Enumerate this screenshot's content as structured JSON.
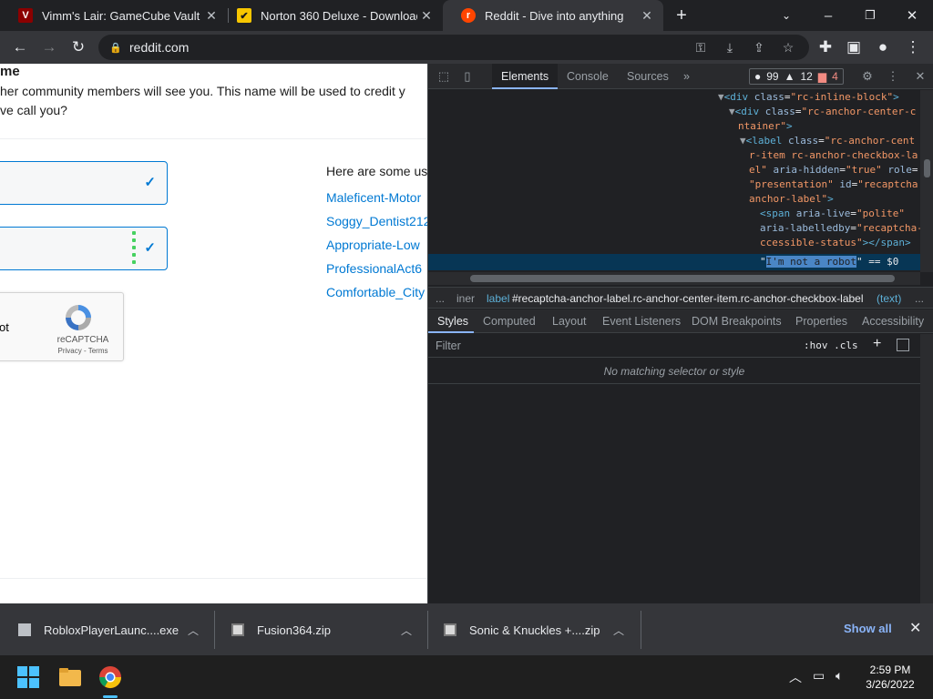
{
  "browser": {
    "tabs": [
      {
        "title": "Vimm's Lair: GameCube Vault",
        "favicon": "V"
      },
      {
        "title": "Norton 360 Deluxe - Download",
        "favicon": "✔"
      },
      {
        "title": "Reddit - Dive into anything",
        "favicon": "r"
      }
    ],
    "url": "reddit.com"
  },
  "page": {
    "heading": "me",
    "desc_line1": "her community members will see you. This name will be used to credit y",
    "desc_line2": "ve call you?",
    "suggestions_title": "Here are some us",
    "suggestions": [
      "Maleficent-Motor",
      "Soggy_Dentist212",
      "Appropriate-Low",
      "ProfessionalAct6",
      "Comfortable_City"
    ],
    "captcha": {
      "label": "ot",
      "brand": "reCAPTCHA",
      "links": "Privacy - Terms"
    }
  },
  "devtools": {
    "tabs": {
      "elements": "Elements",
      "console": "Console",
      "sources": "Sources",
      "more": "»"
    },
    "badges": {
      "info": "99",
      "warnings": "12",
      "errors": "4"
    },
    "breadcrumb": {
      "prefix": "...",
      "item1": "iner",
      "current_tag": "label",
      "current_rest": "#recaptcha-anchor-label.rc-anchor-center-item.rc-anchor-checkbox-label",
      "item3": "(text)",
      "suffix": "..."
    },
    "subtabs": {
      "styles": "Styles",
      "computed": "Computed",
      "layout": "Layout",
      "listeners": "Event Listeners",
      "dom_bp": "DOM Breakpoints",
      "properties": "Properties",
      "accessibility": "Accessibility"
    },
    "filter": {
      "placeholder": "Filter",
      "hov": ":hov",
      "cls": ".cls"
    },
    "no_match": "No matching selector or style"
  },
  "downloads": {
    "items": [
      {
        "name": "RobloxPlayerLaunc....exe"
      },
      {
        "name": "Fusion364.zip"
      },
      {
        "name": "Sonic & Knuckles +....zip"
      }
    ],
    "show_all": "Show all"
  },
  "taskbar": {
    "time": "2:59 PM",
    "date": "3/26/2022"
  }
}
